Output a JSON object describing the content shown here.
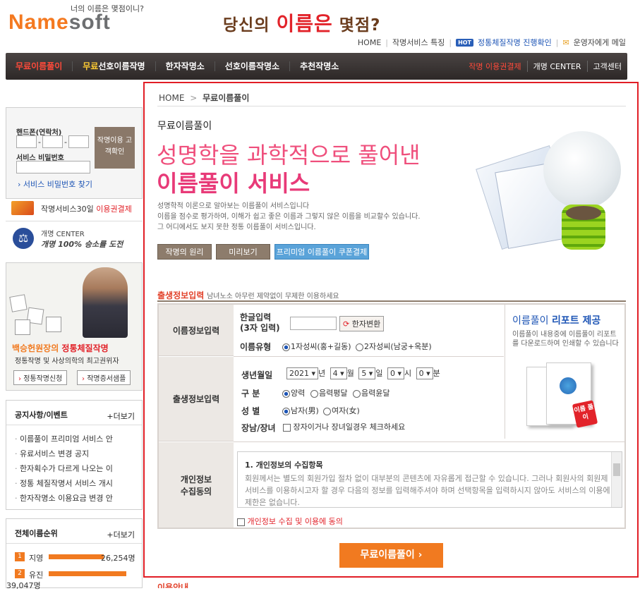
{
  "header": {
    "tagline": "너의 이름은 몇점이니?",
    "logo_orange": "Name",
    "logo_gray": "soft",
    "slogan_pre": "당신의 ",
    "slogan_red": "이름은",
    "slogan_post": " 몇점?",
    "links": [
      "HOME",
      "작명서비스 특징"
    ],
    "hot_badge": "HOT",
    "hot_link": "정통체질작명 진행확인",
    "mail_link": "운영자에게 메일"
  },
  "nav": {
    "items": [
      {
        "label": "무료이름풀이",
        "active": true
      },
      {
        "label_y": "무료",
        "label": "선호이름작명"
      },
      {
        "label": "한자작명소"
      },
      {
        "label": "선호이름작명소"
      },
      {
        "label": "추천작명소"
      }
    ],
    "right": [
      "작명 이용권결제",
      "개명 CENTER",
      "고객센터"
    ]
  },
  "sidebar": {
    "phone_label": "핸드폰(연락처)",
    "password_label": "서비스 비밀번호",
    "login_button": "작명이용 고객확인",
    "find_password": "서비스 비밀번호 찾기",
    "payment_text": "작명서비스30일 ",
    "payment_red": "이용권결제",
    "rename_title": "개명 CENTER",
    "rename_slogan": "개명 100% 승소률 도전",
    "pro_title_a": "백승헌원장의 ",
    "pro_title_b": "정통체질작명",
    "pro_desc": "정통작명 및 사상의학의 최고권위자",
    "pro_btn1": "정통작명신청",
    "pro_btn2": "작명증서샘플",
    "notice_title": "공지사항/이벤트",
    "more": "+더보기",
    "notices": [
      "이름풀이 프리미엄 서비스 안",
      "유료서비스 변경 공지",
      "한자획수가 다르게 나오는 이",
      "정통 체질작명서 서비스 개시",
      "한자작명소 이용요금 변경 안"
    ],
    "rank_title": "전체이름순위",
    "ranks": [
      {
        "rank": "1",
        "name": "지영",
        "count": "26,254명"
      },
      {
        "rank": "2",
        "name": "유진",
        "count": "39,047명"
      }
    ]
  },
  "main": {
    "breadcrumb_home": "HOME",
    "breadcrumb_sep": ">",
    "breadcrumb_current": "무료이름풀이",
    "page_title": "무료이름풀이",
    "hero_line1": "성명학을 과학적으로 풀어낸",
    "hero_line2": "이름풀이 서비스",
    "hero_desc": [
      "성명학적 이론으로 알아보는 이름풀이 서비스입니다",
      "이름을 점수로 평가하여, 이해가 쉽고 좋은 이름과 그렇지 않은 이름을 비교할수 있습니다.",
      "그 어디에서도 보지 못한 정통 이름풀이 서비스입니다."
    ],
    "btn_principle": "작명의 원리",
    "btn_preview": "미리보기",
    "btn_coupon": "프리미엄 이름풀이 쿠폰결제",
    "form_title": "출생정보입력",
    "form_subtitle": "남녀노소 아무런 제약없이 무제한 이용하세요"
  },
  "form": {
    "name_section": "이름정보입력",
    "hangul_label": "한글입력",
    "hangul_sub": "(3자 입력)",
    "hanja_button": "한자변환",
    "type_label": "이름유형",
    "type_opt1": "1자성씨(홍+길동)",
    "type_opt2": "2자성씨(남궁+옥분)",
    "birth_section": "출생정보입력",
    "birth_label": "생년월일",
    "year": "2021",
    "month": "4",
    "day": "5",
    "hour": "0",
    "minute": "0",
    "u_year": "년",
    "u_month": "월",
    "u_day": "일",
    "u_hour": "시",
    "u_minute": "분",
    "cal_label": "구 분",
    "cal_opt1": "양력",
    "cal_opt2": "음력평달",
    "cal_opt3": "음력윤달",
    "sex_label": "성 별",
    "sex_opt1": "남자(男)",
    "sex_opt2": "여자(女)",
    "eldest_label": "장남/장녀",
    "eldest_check": "장자이거나 장녀일경우 체크하세요",
    "privacy_section_1": "개인정보",
    "privacy_section_2": "수집동의",
    "terms_title": "1. 개인정보의 수집항목",
    "terms_text": "회원께서는 별도의 회원가입 절차 없이 대부분의 콘텐츠에 자유롭게 접근할 수 있습니다. 그러나 회원사의 회원제 서비스를 이용하시고자 할 경우 다음의 정보를 입력해주셔야 하며 선택항목을 입력하시지 않아도 서비스의 이용에 제한은 없습니다.",
    "agree_label": "개인정보 수집 및 이용에 동의",
    "submit": "무료이름풀이 ›"
  },
  "report": {
    "title_a": "이름풀이 ",
    "title_b": "리포트 제공",
    "desc": "이름풀이 내용중에 이름풀이 리포트를 다운로드하여 인쇄할 수 있습니다",
    "badge": "이름 풀이"
  },
  "colors": {
    "accent_red": "#e11e26",
    "orange": "#f17a20",
    "pink": "#ef4f7c",
    "nav_bg": "#2d2827"
  }
}
